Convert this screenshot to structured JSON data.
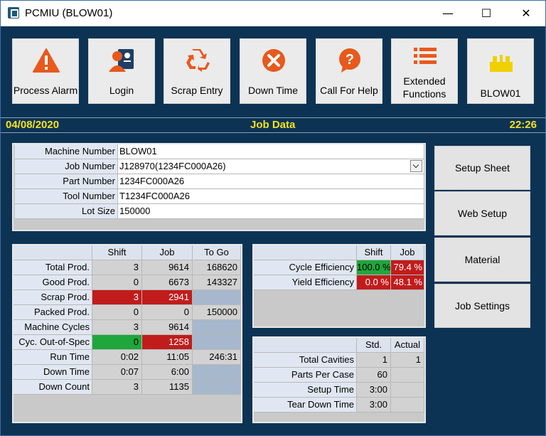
{
  "window": {
    "title": "PCMIU (BLOW01)",
    "minimize": "—",
    "maximize": "☐",
    "close": "✕"
  },
  "toolbar": {
    "process_alarm": "Process Alarm",
    "login": "Login",
    "scrap_entry": "Scrap Entry",
    "down_time": "Down Time",
    "call_for_help": "Call For Help",
    "extended_line1": "Extended",
    "extended_line2": "Functions",
    "blow01": "BLOW01"
  },
  "status": {
    "date": "04/08/2020",
    "title": "Job Data",
    "time": "22:26"
  },
  "job_info": {
    "labels": [
      "Machine Number",
      "Job Number",
      "Part Number",
      "Tool Number",
      "Lot Size"
    ],
    "values": [
      "BLOW01",
      "J128970(1234FC000A26)",
      "1234FC000A26",
      "T1234FC000A26",
      "150000"
    ]
  },
  "prod_table": {
    "headers": [
      "Shift",
      "Job",
      "To Go"
    ],
    "rows": [
      {
        "label": "Total Prod.",
        "shift": "3",
        "job": "9614",
        "togo": "168620"
      },
      {
        "label": "Good Prod.",
        "shift": "0",
        "job": "6673",
        "togo": "143327"
      },
      {
        "label": "Scrap Prod.",
        "shift": "3",
        "job": "2941",
        "togo": ""
      },
      {
        "label": "Packed Prod.",
        "shift": "0",
        "job": "0",
        "togo": "150000"
      },
      {
        "label": "Machine Cycles",
        "shift": "3",
        "job": "9614",
        "togo": ""
      },
      {
        "label": "Cyc. Out-of-Spec",
        "shift": "0",
        "job": "1258",
        "togo": ""
      },
      {
        "label": "Run Time",
        "shift": "0:02",
        "job": "11:05",
        "togo": "246:31"
      },
      {
        "label": "Down Time",
        "shift": "0:07",
        "job": "6:00",
        "togo": ""
      },
      {
        "label": "Down Count",
        "shift": "3",
        "job": "1135",
        "togo": ""
      }
    ]
  },
  "eff_table": {
    "headers": [
      "Shift",
      "Job"
    ],
    "rows": [
      {
        "label": "Cycle Efficiency",
        "shift": "100.0 %",
        "job": "79.4 %"
      },
      {
        "label": "Yield Efficiency",
        "shift": "0.0 %",
        "job": "48.1 %"
      }
    ]
  },
  "cav_table": {
    "headers": [
      "Std.",
      "Actual"
    ],
    "rows": [
      {
        "label": "Total Cavities",
        "std": "1",
        "actual": "1"
      },
      {
        "label": "Parts Per Case",
        "std": "60",
        "actual": ""
      },
      {
        "label": "Setup Time",
        "std": "3:00",
        "actual": ""
      },
      {
        "label": "Tear Down Time",
        "std": "3:00",
        "actual": ""
      }
    ]
  },
  "side_buttons": {
    "setup_sheet": "Setup Sheet",
    "web_setup": "Web Setup",
    "material": "Material",
    "job_settings": "Job Settings"
  },
  "colors": {
    "background": "#0d3354",
    "status_text": "#f4e21c",
    "alarm": "#e8591c",
    "bad": "#c11c1c",
    "good": "#1fa73c"
  },
  "icons": {
    "process_alarm": "warning-triangle-icon",
    "login": "user-badge-icon",
    "scrap_entry": "recycle-icon",
    "down_time": "stop-x-icon",
    "call_for_help": "question-bubble-icon",
    "extended": "list-icon",
    "blow01": "machine-icon"
  }
}
